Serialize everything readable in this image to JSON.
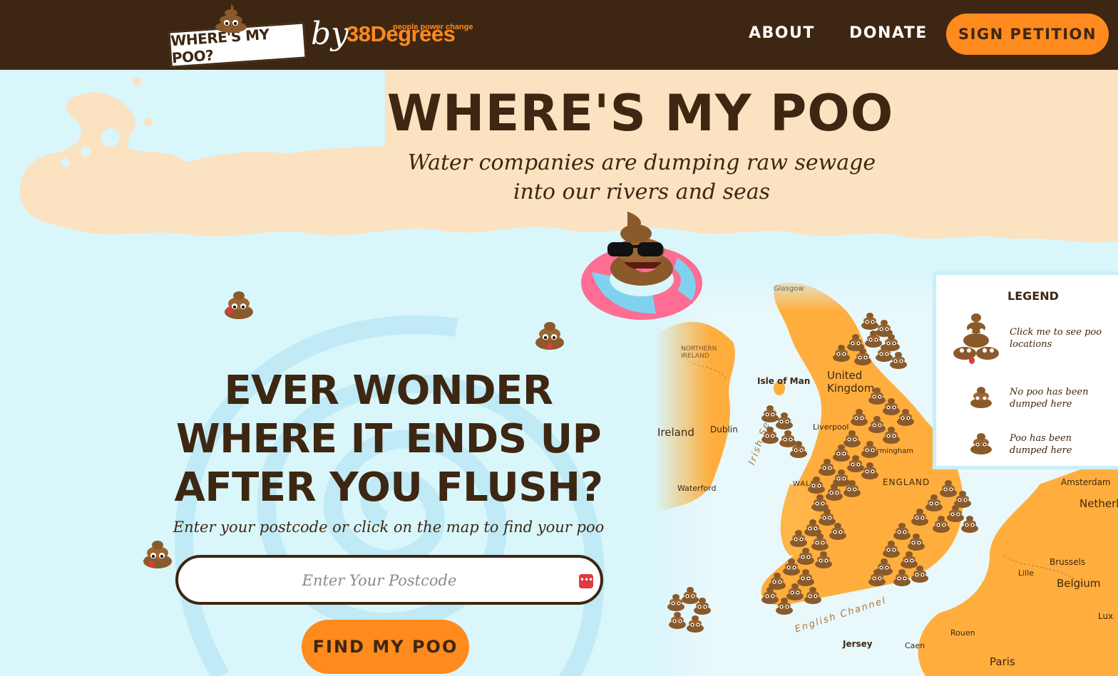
{
  "header": {
    "logo_text": "WHERE'S MY POO?",
    "by_text": "by",
    "brand_name": "38Degrees",
    "brand_tagline": "people power change",
    "nav": {
      "about": "ABOUT",
      "donate": "DONATE",
      "sign_petition": "SIGN PETITION"
    }
  },
  "hero": {
    "title": "WHERE'S MY POO",
    "subtitle": "Water companies are dumping raw sewage into our rivers and seas"
  },
  "search": {
    "heading_line1": "EVER WONDER",
    "heading_line2": "WHERE IT ENDS UP",
    "heading_line3": "AFTER YOU FLUSH?",
    "instructions": "Enter your postcode or click on the map to find your poo",
    "postcode_placeholder": "Enter Your Postcode",
    "find_button": "FIND MY POO"
  },
  "legend": {
    "title": "LEGEND",
    "cluster_text": "Click me to see poo locations",
    "no_poo_text": "No poo has been dumped here",
    "poo_text": "Poo has been dumped here"
  },
  "map": {
    "labels": {
      "glasgow": "Glasgow",
      "northern_ireland": "NORTHERN IRELAND",
      "isle_of_man": "Isle of Man",
      "united_kingdom": "United Kingdom",
      "ireland": "Ireland",
      "dublin": "Dublin",
      "liverpool": "Liverpool",
      "irish_sea": "Irish Sea",
      "birmingham": "Birmingham",
      "england": "ENGLAND",
      "wales": "WALES",
      "waterford": "Waterford",
      "amsterdam": "Amsterdam",
      "netherlands": "Netherl",
      "brussels": "Brussels",
      "belgium": "Belgium",
      "lille": "Lille",
      "english_channel": "English Channel",
      "jersey": "Jersey",
      "rouen": "Rouen",
      "caen": "Caen",
      "paris": "Paris",
      "luxembourg": "Lux"
    }
  },
  "colors": {
    "navbar": "#3d2712",
    "accent": "#ff8a1e",
    "sky": "#d9f6fb",
    "sand": "#fbe2c1",
    "land": "#ffae3d",
    "text": "#3d2712"
  }
}
